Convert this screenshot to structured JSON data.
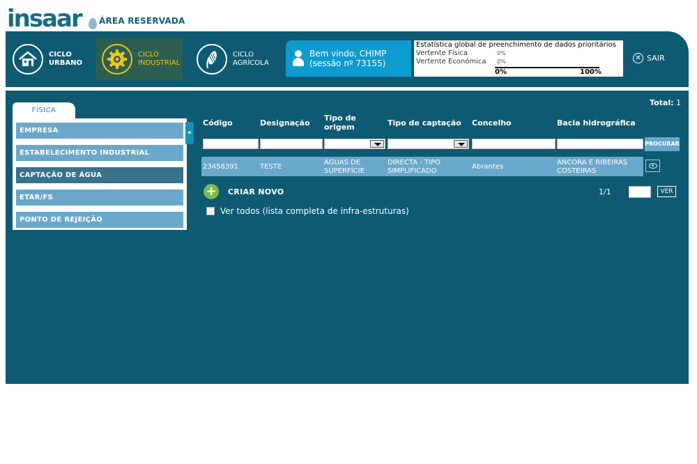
{
  "header": {
    "logo_text": "insaar",
    "area_label": "ÁREA RESERVADA"
  },
  "nav": {
    "urbano": {
      "line1": "CICLO",
      "line2": "URBANO",
      "icon": "house-icon"
    },
    "industrial": {
      "line1": "CICLO",
      "line2": "INDUSTRIAL",
      "icon": "gear-icon"
    },
    "agricola": {
      "line1": "CICLO",
      "line2": "AGRÍCOLA",
      "icon": "corn-icon"
    }
  },
  "welcome": {
    "line1": "Bem vindo, CHIMP",
    "line2": "(sessão nº 73155)"
  },
  "stats": {
    "title": "Estatística global de preenchimento de dados prioritários",
    "rows": [
      {
        "label": "Vertente Física",
        "value": "0%"
      },
      {
        "label": "Vertente Económica",
        "value": "0%"
      }
    ],
    "scale_min": "0%",
    "scale_max": "100%"
  },
  "sair_label": "SAIR",
  "sidebar": {
    "tab": "FÍSICA",
    "collapse_label": "«",
    "items": [
      {
        "label": "EMPRESA"
      },
      {
        "label": "ESTABELECIMENTO INDUSTRIAL"
      },
      {
        "label": "CAPTAÇÃO DE ÁGUA"
      },
      {
        "label": "ETAR/FS"
      },
      {
        "label": "PONTO DE REJEIÇÃO"
      }
    ]
  },
  "table": {
    "total_label": "Total:",
    "total_value": "1",
    "headers": {
      "codigo": "Código",
      "designacao": "Designação",
      "tipo_origem_1": "Tipo de",
      "tipo_origem_2": "origem",
      "tipo_captacao": "Tipo de captação",
      "concelho": "Concelho",
      "bacia": "Bacia hidrográfica"
    },
    "search_button": "PROCURAR",
    "rows": [
      {
        "codigo": "23458391",
        "designacao": "TESTE",
        "tipo_origem_1": "ÁGUAS DE",
        "tipo_origem_2": "SUPERFÍCIE",
        "tipo_captacao_1": "DIRECTA - TIPO",
        "tipo_captacao_2": "SIMPLIFICADO",
        "concelho": "Abrantes",
        "bacia_1": "ANCORA E RIBEIRAS",
        "bacia_2": "COSTEIRAS"
      }
    ]
  },
  "actions": {
    "criar_novo": "CRIAR NOVO",
    "paging": "1/1",
    "ver": "VER",
    "ver_todos": "Ver todos (lista completa de infra-estruturas)"
  },
  "colors": {
    "primary": "#0e5a73",
    "accent": "#0e9bd0",
    "industrial": "#f2c41a",
    "item": "#6aa8cb",
    "item_active": "#39728c",
    "add": "#7eb84a"
  }
}
